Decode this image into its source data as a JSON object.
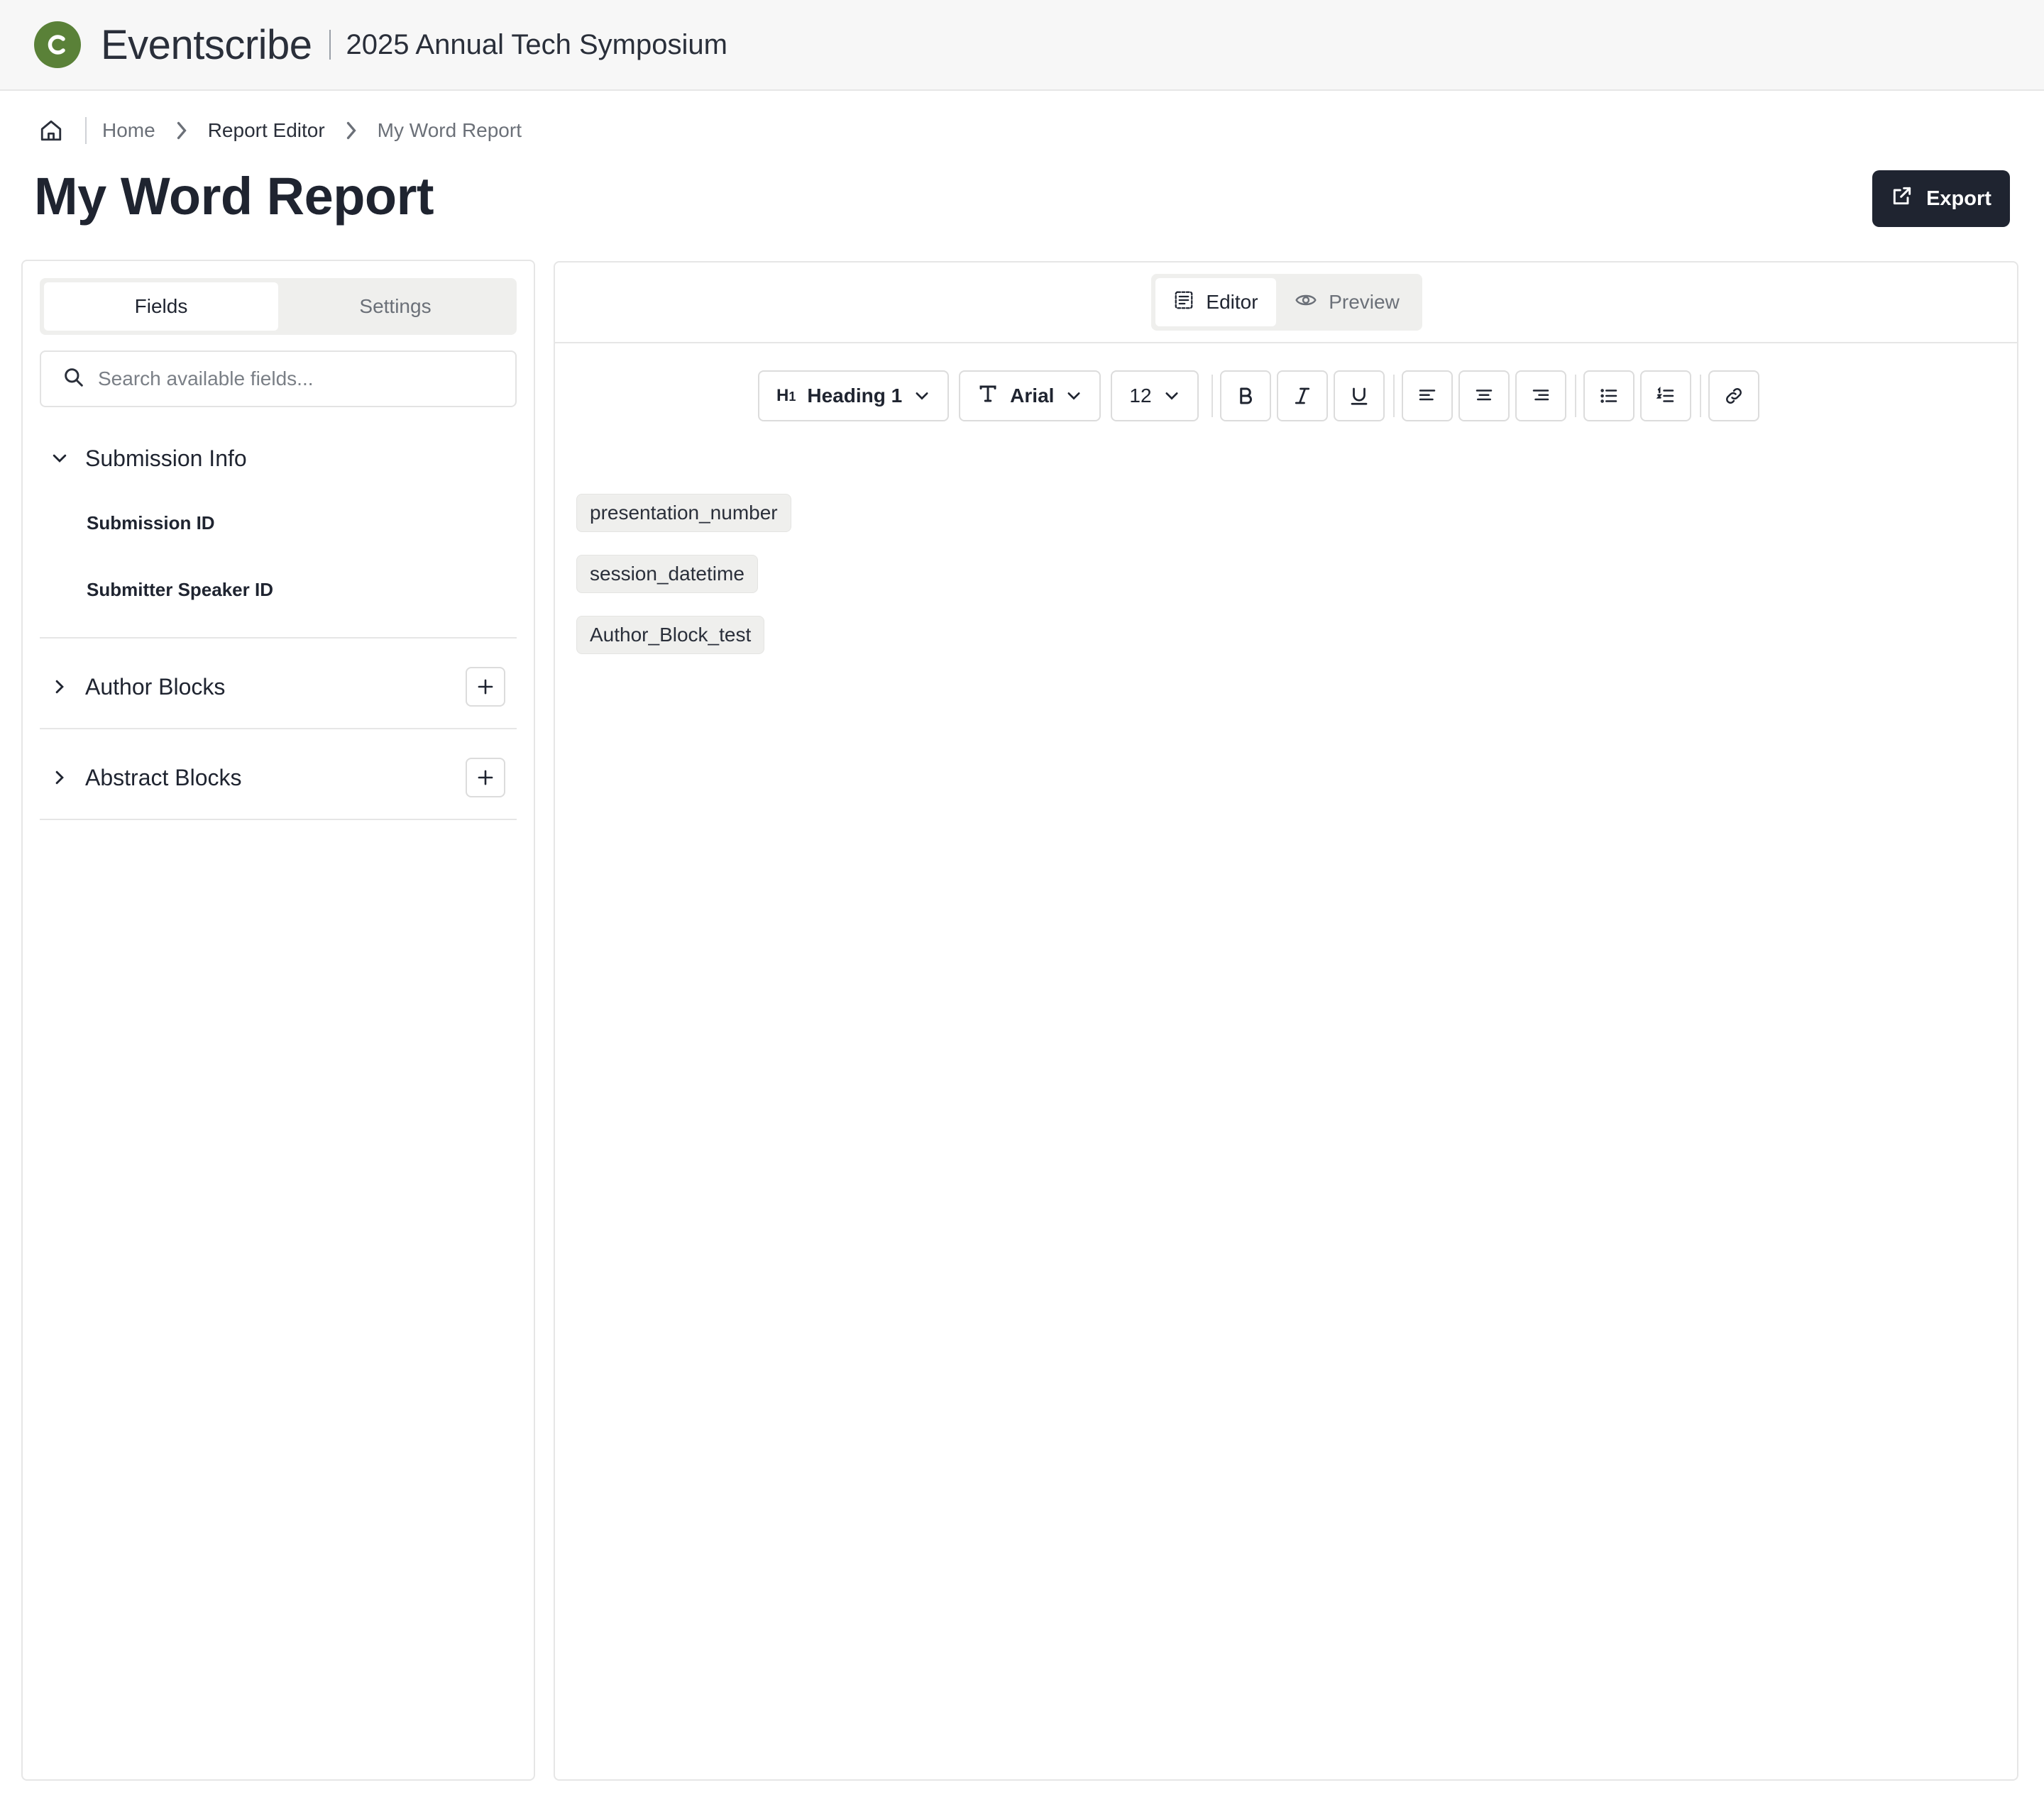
{
  "header": {
    "brand": "Eventscribe",
    "event_title": "2025 Annual Tech Symposium"
  },
  "breadcrumb": {
    "items": [
      "Home",
      "Report Editor",
      "My Word Report"
    ]
  },
  "page": {
    "title": "My Word Report",
    "export_label": "Export"
  },
  "left_panel": {
    "tabs": [
      {
        "label": "Fields",
        "active": true
      },
      {
        "label": "Settings",
        "active": false
      }
    ],
    "search": {
      "placeholder": "Search available fields...",
      "value": ""
    },
    "sections": [
      {
        "label": "Submission Info",
        "expanded": true,
        "fields": [
          "Submission ID",
          "Submitter Speaker ID"
        ]
      },
      {
        "label": "Author Blocks",
        "expanded": false
      },
      {
        "label": "Abstract Blocks",
        "expanded": false
      }
    ]
  },
  "editor": {
    "view_tabs": [
      {
        "label": "Editor",
        "active": true
      },
      {
        "label": "Preview",
        "active": false
      }
    ],
    "toolbar": {
      "heading": "Heading 1",
      "font": "Arial",
      "size": "12"
    },
    "chips": [
      "presentation_number",
      "session_datetime",
      "Author_Block_test"
    ]
  },
  "colors": {
    "brand_green": "#5a8138",
    "dark": "#1f2430"
  },
  "icons": [
    "logo-icon",
    "home-icon",
    "chevron-right-icon",
    "external-link-icon",
    "search-icon",
    "chevron-down-icon",
    "chevron-right-icon",
    "plus-icon",
    "editor-icon",
    "eye-icon",
    "heading-icon",
    "type-icon",
    "bold-icon",
    "italic-icon",
    "underline-icon",
    "align-left-icon",
    "align-center-icon",
    "align-right-icon",
    "bullet-list-icon",
    "numbered-list-icon",
    "link-icon"
  ]
}
